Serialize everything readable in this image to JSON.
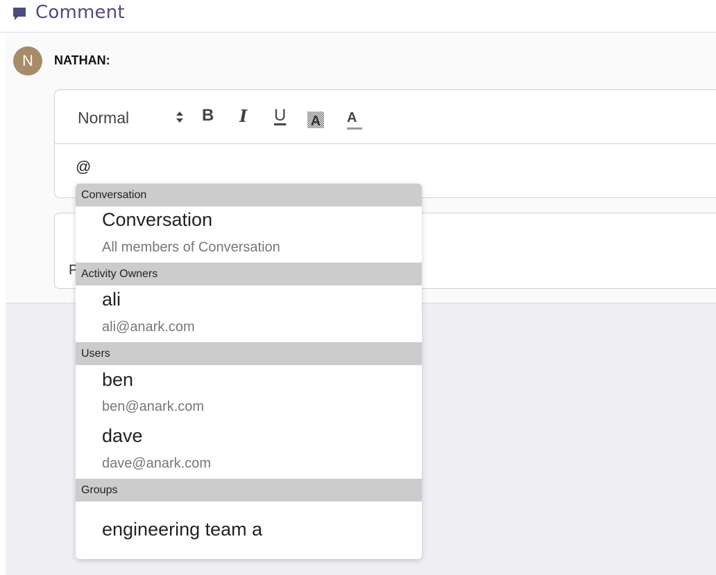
{
  "header": {
    "title": "Comment",
    "icon": "comment-icon",
    "accent": "#4b4a82"
  },
  "author": {
    "initial": "N",
    "name": "NATHAN:",
    "avatar_color": "#a88b67"
  },
  "toolbar": {
    "format": "Normal",
    "bold": "B",
    "italic": "I",
    "underline": "U",
    "color": "A"
  },
  "editor": {
    "text": "@"
  },
  "card2": {
    "text": "P"
  },
  "mention_list": {
    "groups": [
      {
        "header": "Conversation",
        "items": [
          {
            "name": "Conversation",
            "sub": "All members of Conversation"
          }
        ]
      },
      {
        "header": "Activity Owners",
        "items": [
          {
            "name": "ali",
            "sub": "ali@anark.com"
          }
        ]
      },
      {
        "header": "Users",
        "items": [
          {
            "name": "ben",
            "sub": "ben@anark.com"
          },
          {
            "name": "dave",
            "sub": "dave@anark.com"
          }
        ]
      },
      {
        "header": "Groups",
        "items": [
          {
            "name": "engineering team a"
          }
        ]
      }
    ]
  }
}
